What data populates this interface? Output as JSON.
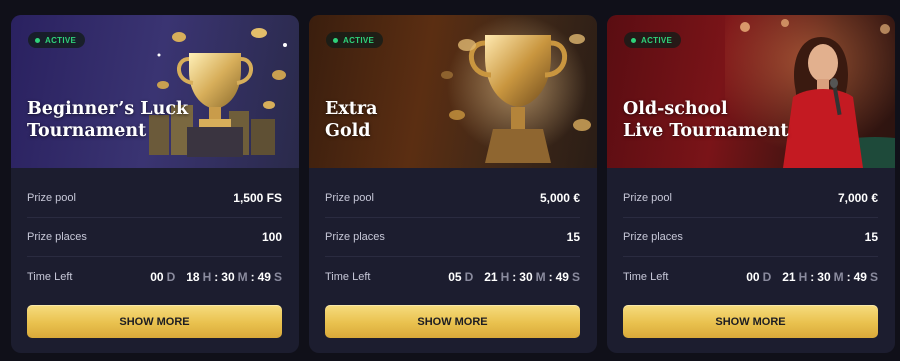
{
  "cards": [
    {
      "status": "ACTIVE",
      "title": "Beginner’s Luck\nTournament",
      "prize_pool_label": "Prize pool",
      "prize_pool_value": "1,500 FS",
      "prize_places_label": "Prize places",
      "prize_places_value": "100",
      "time_left_label": "Time Left",
      "timer": {
        "days": "00",
        "hours": "18",
        "minutes": "30",
        "seconds": "49"
      },
      "button_label": "SHOW MORE",
      "image_icon": "trophy-coins-icon"
    },
    {
      "status": "ACTIVE",
      "title": "Extra\nGold",
      "prize_pool_label": "Prize pool",
      "prize_pool_value": "5,000 €",
      "prize_places_label": "Prize places",
      "prize_places_value": "15",
      "time_left_label": "Time Left",
      "timer": {
        "days": "05",
        "hours": "21",
        "minutes": "30",
        "seconds": "49"
      },
      "button_label": "SHOW MORE",
      "image_icon": "gold-cup-coins-icon"
    },
    {
      "status": "ACTIVE",
      "title": "Old-school\nLive Tournament",
      "prize_pool_label": "Prize pool",
      "prize_pool_value": "7,000 €",
      "prize_places_label": "Prize places",
      "prize_places_value": "15",
      "time_left_label": "Time Left",
      "timer": {
        "days": "00",
        "hours": "21",
        "minutes": "30",
        "seconds": "49"
      },
      "button_label": "SHOW MORE",
      "image_icon": "live-host-icon"
    }
  ],
  "timer_units": {
    "days": "D",
    "hours": "H",
    "minutes": "M",
    "seconds": "S"
  },
  "colors": {
    "page_bg": "#101019",
    "card_bg": "#1c1d2f",
    "active_green": "#2fd27a",
    "button_gold": "#e9c14e"
  }
}
